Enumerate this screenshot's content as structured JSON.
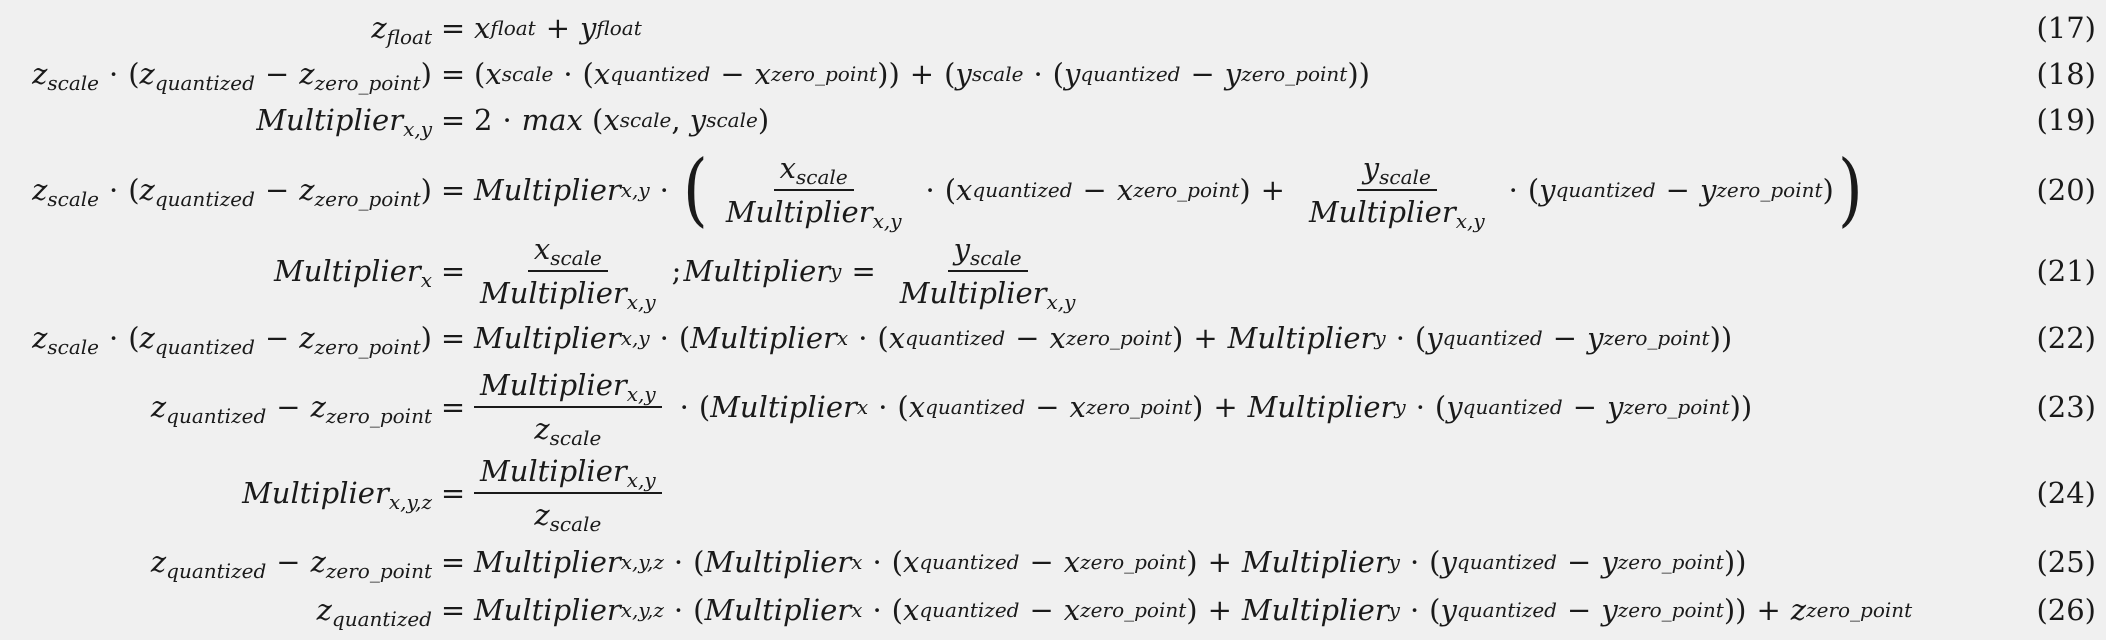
{
  "equations": [
    {
      "id": "17",
      "number": "(17)"
    },
    {
      "id": "18",
      "number": "(18)"
    },
    {
      "id": "19",
      "number": "(19)"
    },
    {
      "id": "20",
      "number": "(20)"
    },
    {
      "id": "21",
      "number": "(21)"
    },
    {
      "id": "22",
      "number": "(22)"
    },
    {
      "id": "23",
      "number": "(23)"
    },
    {
      "id": "24",
      "number": "(24)"
    },
    {
      "id": "25",
      "number": "(25)"
    },
    {
      "id": "26",
      "number": "(26)"
    }
  ],
  "sym": {
    "z": "z",
    "x": "x",
    "y": "y",
    "multiplier": "Multiplier",
    "max": "max",
    "two": "2",
    "float": "float",
    "scale": "scale",
    "quantized": "quantized",
    "zero_point": "zero_point",
    "xy": "x,y",
    "xyz": "x,y,z",
    "sx": "x",
    "sy": "y"
  }
}
